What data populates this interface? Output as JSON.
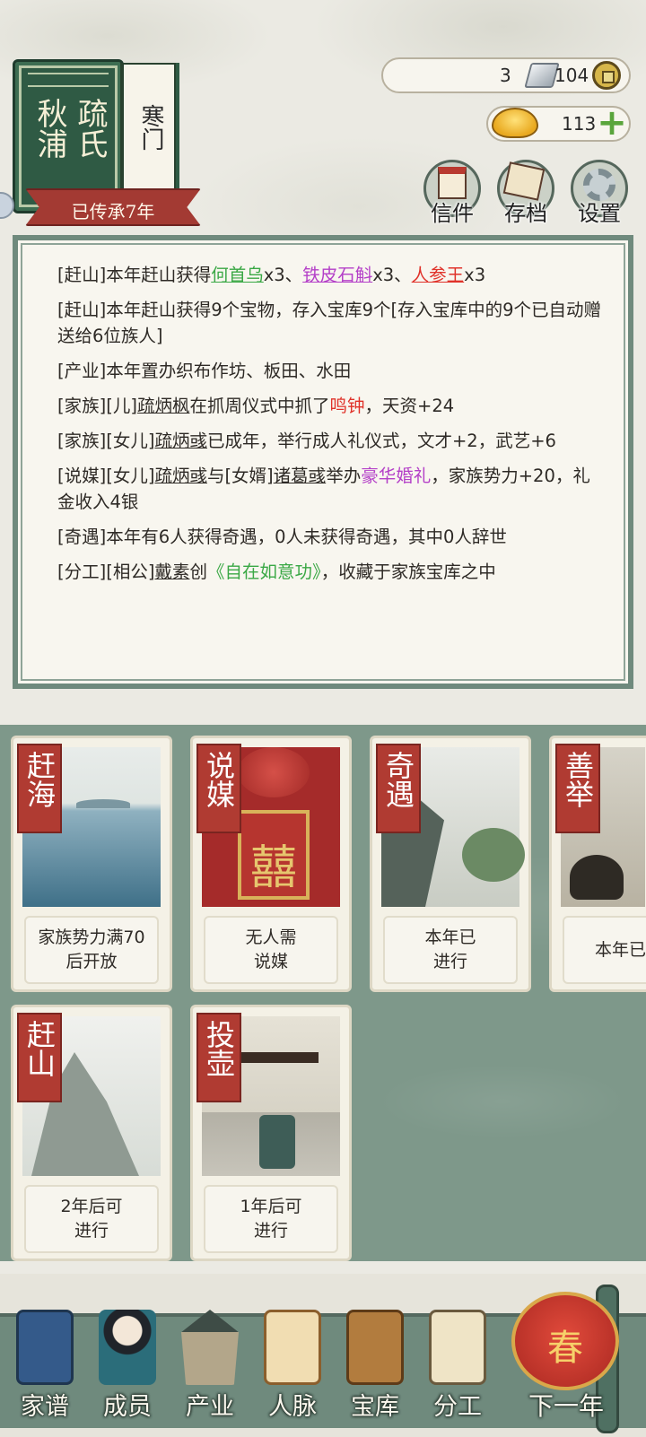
{
  "header": {
    "family_surname_chars": [
      "疏",
      "氏"
    ],
    "place_chars": [
      "秋",
      "浦"
    ],
    "status": "寒门",
    "inherited": "已传承7年"
  },
  "resources": {
    "silver": "3",
    "copper": "104",
    "gold": "113"
  },
  "top_buttons": {
    "letters": "信件",
    "save": "存档",
    "settings": "设置"
  },
  "log": [
    {
      "parts": [
        {
          "t": "[赶山]本年赶山获得"
        },
        {
          "t": "何首乌",
          "c": "green-t u"
        },
        {
          "t": "x3、"
        },
        {
          "t": "铁皮石斛",
          "c": "purple-t u"
        },
        {
          "t": "x3、"
        },
        {
          "t": "人参王",
          "c": "red-t u"
        },
        {
          "t": "x3"
        }
      ]
    },
    {
      "parts": [
        {
          "t": "[赶山]本年赶山获得9个宝物，存入宝库9个[存入宝库中的9个已自动赠送给6位族人]"
        }
      ]
    },
    {
      "parts": [
        {
          "t": "[产业]本年置办织布作坊、板田、水田"
        }
      ]
    },
    {
      "parts": [
        {
          "t": "[家族][儿]"
        },
        {
          "t": "疏炳枫",
          "c": "u"
        },
        {
          "t": "在抓周仪式中抓了"
        },
        {
          "t": "鸣钟",
          "c": "red-t"
        },
        {
          "t": "，天资+24"
        }
      ]
    },
    {
      "parts": [
        {
          "t": "[家族][女儿]"
        },
        {
          "t": "疏炳彧",
          "c": "u"
        },
        {
          "t": "已成年，举行成人礼仪式，文才+2，武艺+6"
        }
      ]
    },
    {
      "parts": [
        {
          "t": "[说媒][女儿]"
        },
        {
          "t": "疏炳彧",
          "c": "u"
        },
        {
          "t": "与[女婿]"
        },
        {
          "t": "诸葛彧",
          "c": "u"
        },
        {
          "t": "举办"
        },
        {
          "t": "豪华婚礼",
          "c": "purple-t"
        },
        {
          "t": "，家族势力+20，礼金收入4银"
        }
      ]
    },
    {
      "parts": [
        {
          "t": "[奇遇]本年有6人获得奇遇，0人未获得奇遇，其中0人辞世"
        }
      ]
    },
    {
      "parts": [
        {
          "t": "[分工][相公]"
        },
        {
          "t": "戴素",
          "c": "u"
        },
        {
          "t": "创"
        },
        {
          "t": "《自在如意功》",
          "c": "green-t"
        },
        {
          "t": "，收藏于家族宝库之中"
        }
      ]
    }
  ],
  "activities": [
    {
      "name": "赶海",
      "status": "家族势力满70\n后开放"
    },
    {
      "name": "说媒",
      "status": "无人需\n说媒"
    },
    {
      "name": "奇遇",
      "status": "本年已\n进行"
    },
    {
      "name": "善举",
      "status": "本年已进"
    },
    {
      "name": "赶山",
      "status": "2年后可\n进行"
    },
    {
      "name": "投壶",
      "status": "1年后可\n进行"
    }
  ],
  "wedding_glyph": "囍",
  "bottom_nav": {
    "genealogy": "家谱",
    "members": "成员",
    "property": "产业",
    "network": "人脉",
    "treasury": "宝库",
    "division": "分工",
    "next_year": "下一年",
    "season": "春"
  },
  "colors": {
    "accent_red": "#b03b32",
    "panel_green": "#6f8a7d",
    "rare_green": "#3aa845",
    "rare_purple": "#b440c8",
    "rare_red": "#e0322a"
  }
}
